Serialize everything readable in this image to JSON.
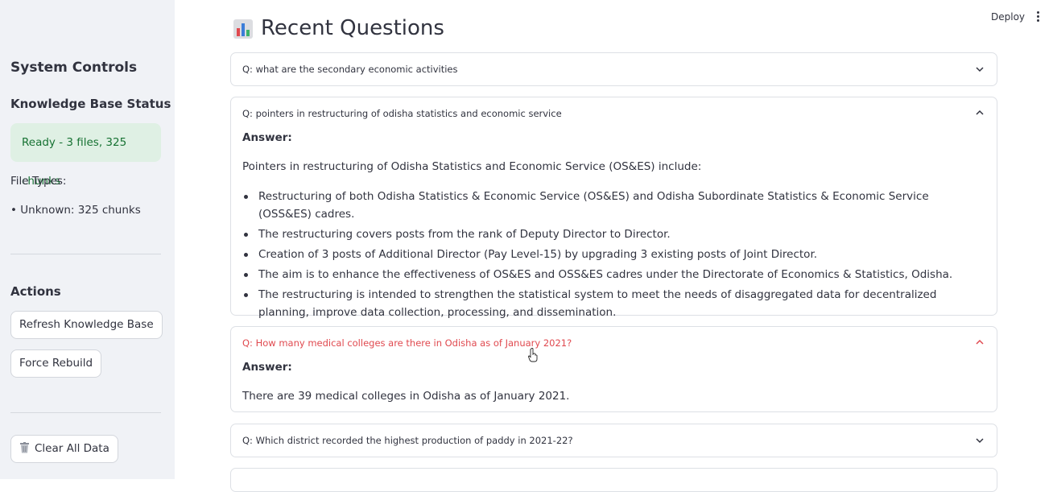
{
  "sidebar": {
    "heading": "System Controls",
    "kb_status_heading": "Knowledge Base Status",
    "kb_status": "Ready - 3 files, 325 chunks",
    "file_types_label": "File Types:",
    "file_types_item": "• Unknown: 325 chunks",
    "actions_heading": "Actions",
    "refresh_button": "Refresh Knowledge Base",
    "rebuild_button": "Force Rebuild",
    "clear_button": "Clear All Data"
  },
  "header": {
    "deploy_label": "Deploy"
  },
  "main": {
    "title": "Recent Questions",
    "questions": [
      {
        "question": "Q: what are the secondary economic activities"
      },
      {
        "question": "Q: pointers in restructuring of odisha statistics and economic service",
        "answer_label": "Answer:",
        "answer_intro": "Pointers in restructuring of Odisha Statistics and Economic Service (OS&ES) include:",
        "bullets": [
          "Restructuring of both Odisha Statistics & Economic Service (OS&ES) and Odisha Subordinate Statistics & Economic Service (OSS&ES) cadres.",
          "The restructuring covers posts from the rank of Deputy Director to Director.",
          "Creation of 3 posts of Additional Director (Pay Level-15) by upgrading 3 existing posts of Joint Director.",
          "The aim is to enhance the effectiveness of OS&ES and OSS&ES cadres under the Directorate of Economics & Statistics, Odisha.",
          "The restructuring is intended to strengthen the statistical system to meet the needs of disaggregated data for decentralized planning, improve data collection, processing, and dissemination."
        ]
      },
      {
        "question": "Q: How many medical colleges are there in Odisha as of January 2021?",
        "answer_label": "Answer:",
        "answer_text": "There are 39 medical colleges in Odisha as of January 2021."
      },
      {
        "question": "Q: Which district recorded the highest production of paddy in 2021-22?"
      }
    ]
  },
  "colors": {
    "sidebar_bg": "#f0f2f6",
    "status_bg": "#dff0e4",
    "status_text": "#177233",
    "hover_text": "#e0494f"
  }
}
